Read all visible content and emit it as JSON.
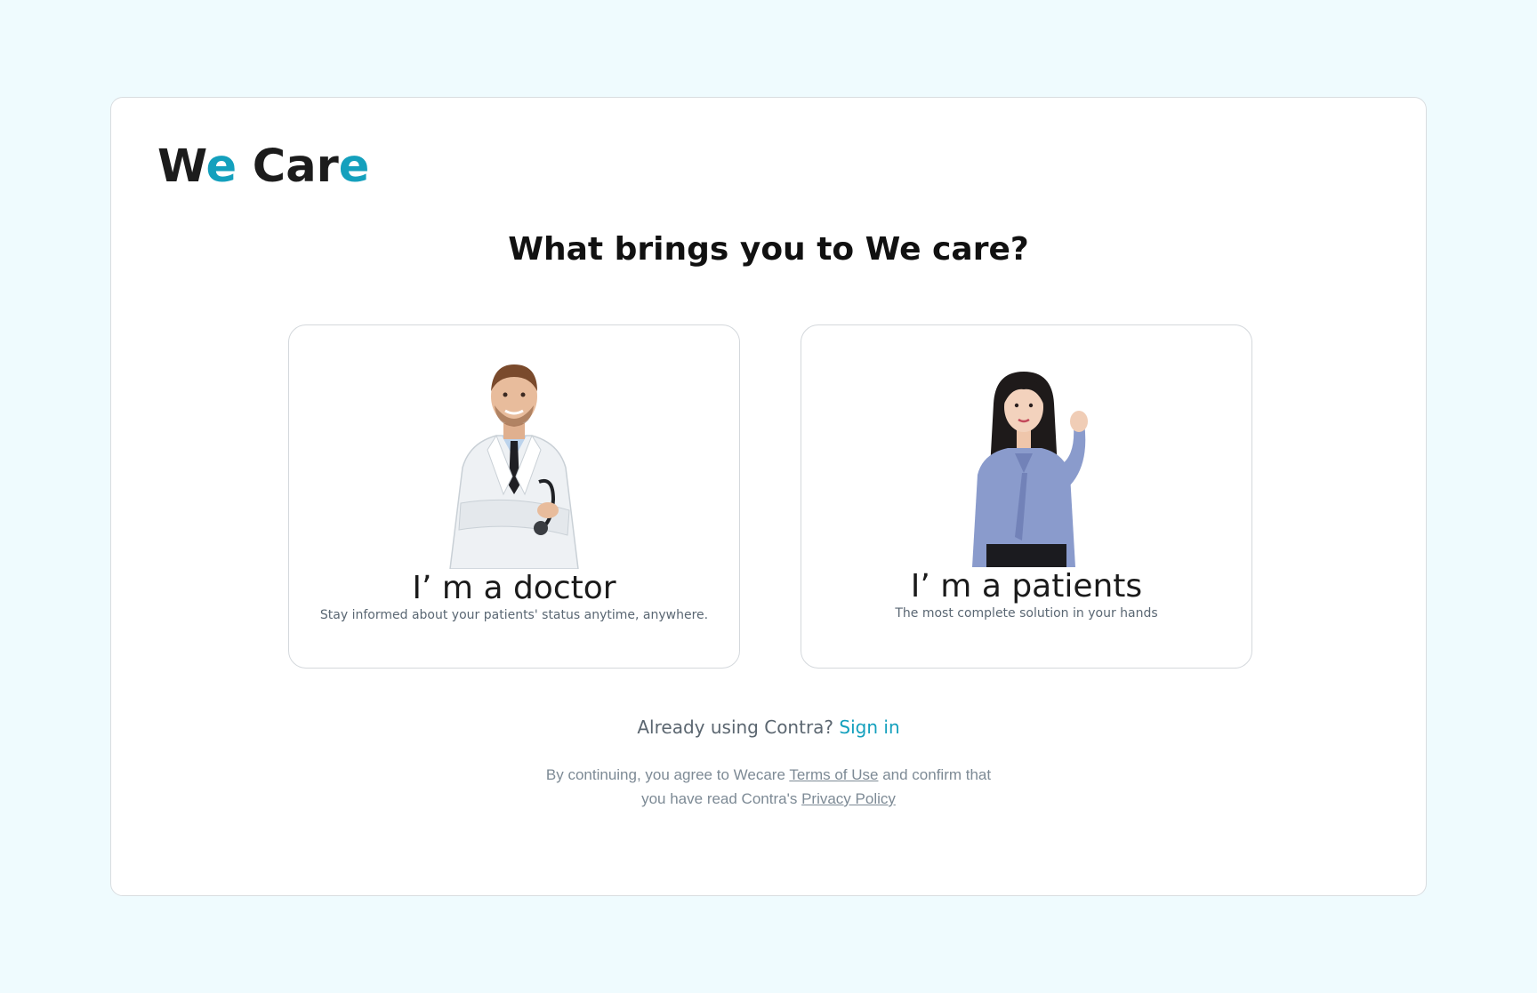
{
  "brand": {
    "part1": "W",
    "part2": "e",
    "part3": " Car",
    "part4": "e",
    "accent_color": "#14a0bd"
  },
  "headline": "What brings you to We care?",
  "roles": [
    {
      "icon": "doctor-photo",
      "title": "I’ m a doctor",
      "description": "Stay informed about your patients' status anytime, anywhere."
    },
    {
      "icon": "patient-photo",
      "title": "I’ m a patients",
      "description": "The most complete solution in your hands"
    }
  ],
  "signin": {
    "prompt": "Already using Contra?",
    "link": "Sign in"
  },
  "legal": {
    "line1_prefix": "By continuing, you agree to Wecare",
    "terms_link": "Terms of Use",
    "line1_suffix": "and confirm that",
    "line2_prefix": "you have read Contra's",
    "privacy_link": "Privacy Policy"
  },
  "colors": {
    "background": "#effbfe",
    "card_border": "#d9dde0",
    "accent": "#14a0bd"
  }
}
